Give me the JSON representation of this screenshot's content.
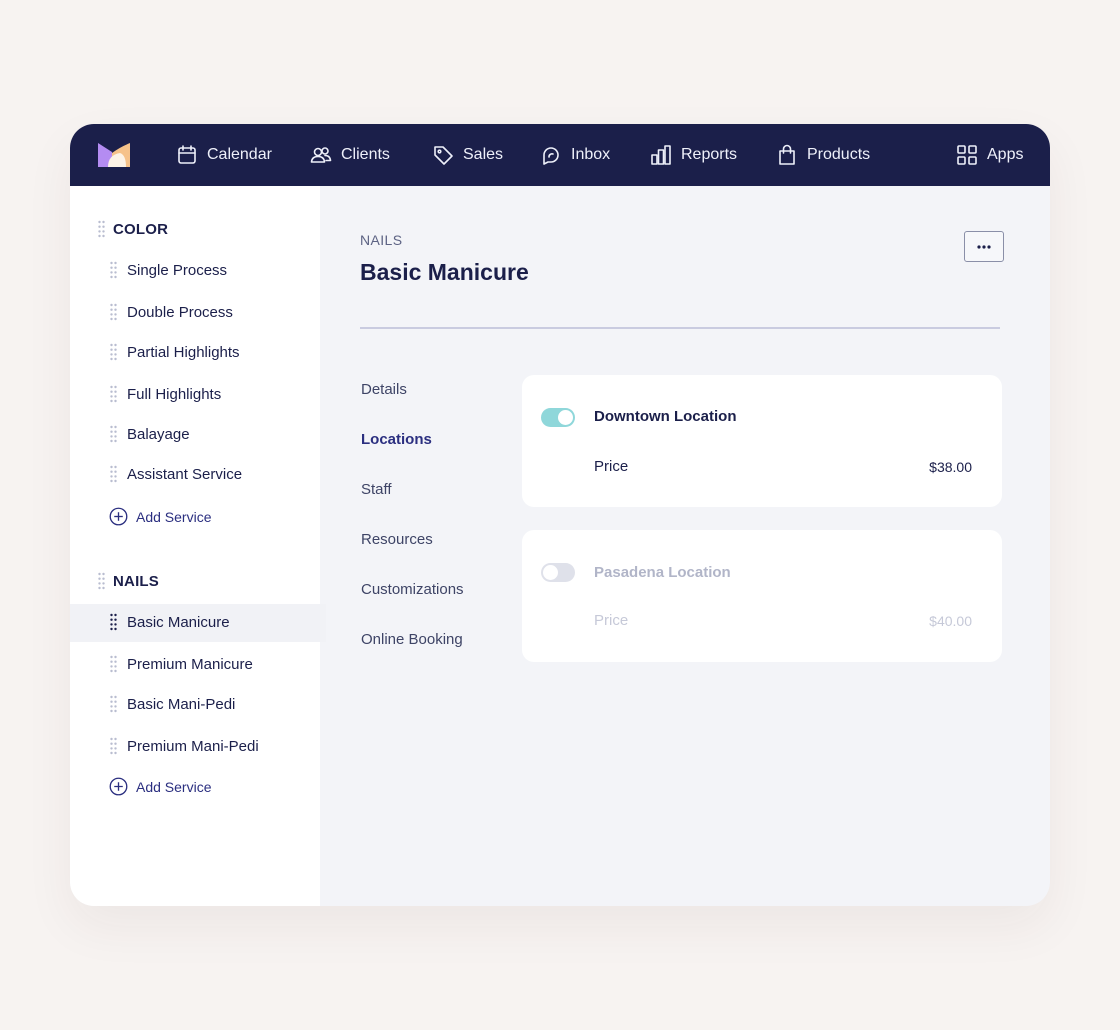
{
  "nav": {
    "items": [
      {
        "label": "Calendar",
        "icon": "calendar-icon"
      },
      {
        "label": "Clients",
        "icon": "users-icon"
      },
      {
        "label": "Sales",
        "icon": "tag-icon"
      },
      {
        "label": "Inbox",
        "icon": "chat-icon"
      },
      {
        "label": "Reports",
        "icon": "bar-chart-icon"
      },
      {
        "label": "Products",
        "icon": "shopping-bag-icon"
      }
    ],
    "apps_label": "Apps"
  },
  "sidebar": {
    "groups": [
      {
        "title": "COLOR",
        "services": [
          "Single Process",
          "Double Process",
          "Partial Highlights",
          "Full Highlights",
          "Balayage",
          "Assistant Service"
        ],
        "add_label": "Add Service"
      },
      {
        "title": "NAILS",
        "services": [
          "Basic Manicure",
          "Premium Manicure",
          "Basic Mani-Pedi",
          "Premium Mani-Pedi"
        ],
        "add_label": "Add Service",
        "selected": "Basic Manicure"
      }
    ]
  },
  "main": {
    "breadcrumb": "NAILS",
    "title": "Basic Manicure",
    "tabs": [
      "Details",
      "Locations",
      "Staff",
      "Resources",
      "Customizations",
      "Online Booking"
    ],
    "active_tab": "Locations",
    "locations": [
      {
        "name": "Downtown Location",
        "enabled": true,
        "price_label": "Price",
        "price": "$38.00"
      },
      {
        "name": "Pasadena Location",
        "enabled": false,
        "price_label": "Price",
        "price": "$40.00"
      }
    ]
  },
  "colors": {
    "nav_bg": "#1b1f4a",
    "accent": "#2b2f80",
    "toggle_on": "#8fd7da",
    "page_bg": "#f7f3f1"
  }
}
